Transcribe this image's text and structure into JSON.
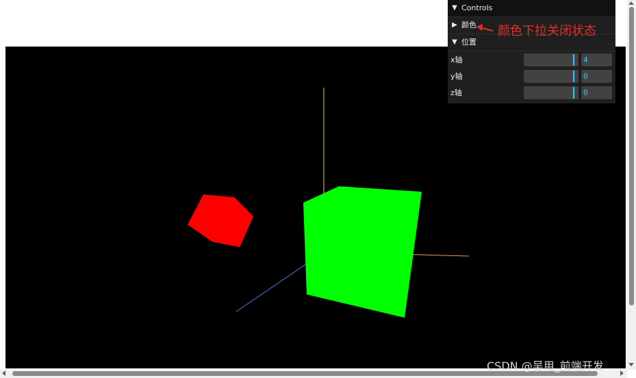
{
  "gui": {
    "title": "Controls",
    "folders": {
      "color": {
        "label": "颜色",
        "state": "collapsed"
      },
      "position": {
        "label": "位置",
        "state": "expanded",
        "rows": [
          {
            "label": "x轴",
            "value": "4"
          },
          {
            "label": "y轴",
            "value": "0"
          },
          {
            "label": "z轴",
            "value": "0"
          }
        ]
      }
    },
    "accent_color": "#2cc9ff"
  },
  "annotation": {
    "text": "颜色下拉关闭状态",
    "color": "#e33024"
  },
  "scene": {
    "background": "#000000",
    "objects": [
      {
        "name": "red-cube",
        "color": "#ff0000"
      },
      {
        "name": "green-cube",
        "color": "#00ff00"
      },
      {
        "name": "axes-helper",
        "colors": [
          "#ffff00",
          "#ff8800",
          "#3399ff"
        ]
      }
    ]
  },
  "watermark": "CSDN @吴用_前端开发"
}
